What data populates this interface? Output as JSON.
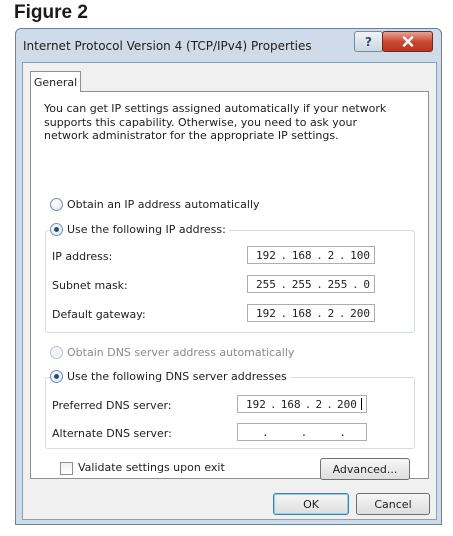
{
  "figure_caption": "Figure 2",
  "window": {
    "title": "Internet Protocol Version 4 (TCP/IPv4) Properties",
    "help_label": "?"
  },
  "tabs": [
    {
      "label": "General"
    }
  ],
  "intro_text": "You can get IP settings assigned automatically if your network supports this capability. Otherwise, you need to ask your network administrator for the appropriate IP settings.",
  "ip_mode": {
    "auto_label": "Obtain an IP address automatically",
    "manual_label": "Use the following IP address:",
    "selected": "manual"
  },
  "ip_fields": [
    {
      "label": "IP address:",
      "octets": [
        "192",
        "168",
        "2",
        "100"
      ]
    },
    {
      "label": "Subnet mask:",
      "octets": [
        "255",
        "255",
        "255",
        "0"
      ]
    },
    {
      "label": "Default gateway:",
      "octets": [
        "192",
        "168",
        "2",
        "200"
      ]
    }
  ],
  "dns_mode": {
    "auto_label": "Obtain DNS server address automatically",
    "manual_label": "Use the following DNS server addresses",
    "selected": "manual"
  },
  "dns_fields": [
    {
      "label": "Preferred DNS server:",
      "octets": [
        "192",
        "168",
        "2",
        "200"
      ]
    },
    {
      "label": "Alternate DNS server:",
      "octets": [
        "",
        "",
        "",
        ""
      ]
    }
  ],
  "validate": {
    "label": "Validate settings upon exit",
    "checked": false
  },
  "buttons": {
    "advanced": "Advanced...",
    "ok": "OK",
    "cancel": "Cancel"
  },
  "colors": {
    "close_button": "#c8442e",
    "frame": "#cfdbe8",
    "radio_dot": "#1f4f8a"
  }
}
